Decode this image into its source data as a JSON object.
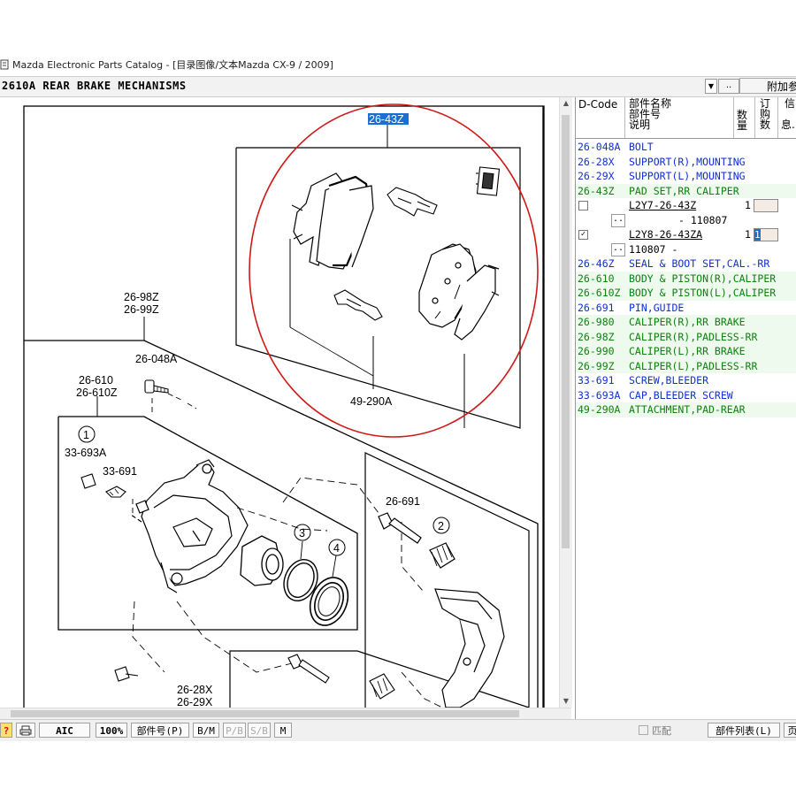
{
  "window": {
    "title": "Mazda Electronic Parts Catalog - [目录图像/文本Mazda CX-9 / 2009]"
  },
  "section": {
    "title": "2610A  REAR BRAKE MECHANISMS",
    "more_label": "..",
    "attach_label": "附加",
    "attach_extra": "参"
  },
  "diagram": {
    "highlight_label": "26-43Z",
    "labels": {
      "l_26_98z": "26-98Z",
      "l_26_99z": "26-99Z",
      "l_26_048a": "26-048A",
      "l_26_610": "26-610",
      "l_26_610z": "26-610Z",
      "l_1": "1",
      "l_33_693a": "33-693A",
      "l_33_691": "33-691",
      "l_26_691": "26-691",
      "l_2": "2",
      "l_3": "3",
      "l_4": "4",
      "l_49_290a": "49-290A",
      "l_26_28x": "26-28X",
      "l_26_29x": "26-29X"
    }
  },
  "parts_panel": {
    "headers": {
      "dcode": "D-Code",
      "name1": "部件名称",
      "name2": "部件号",
      "name3": "说明",
      "qty1": "数",
      "qty2": "量",
      "order1": "订",
      "order2": "购",
      "order3": "数",
      "info1": "信",
      "info2": "息."
    },
    "rows": [
      {
        "code": "26-048A",
        "desc": "BOLT",
        "color": "blue"
      },
      {
        "code": "26-28X",
        "desc": "SUPPORT(R),MOUNTING",
        "color": "blue"
      },
      {
        "code": "26-29X",
        "desc": "SUPPORT(L),MOUNTING",
        "color": "blue"
      },
      {
        "code": "26-43Z",
        "desc": "PAD SET,RR CALIPER",
        "color": "green"
      }
    ],
    "sub_rows": [
      {
        "part": "L2Y7-26-43Z",
        "qty": "1",
        "range": "- 110807",
        "checked": false
      },
      {
        "part": "L2Y8-26-43ZA",
        "qty": "1",
        "order": "1",
        "range": "110807  -",
        "checked": true
      }
    ],
    "rows_after": [
      {
        "code": "26-46Z",
        "desc": "SEAL & BOOT SET,CAL.-RR",
        "color": "blue"
      },
      {
        "code": "26-610",
        "desc": "BODY & PISTON(R),CALIPER",
        "color": "green"
      },
      {
        "code": "26-610Z",
        "desc": "BODY & PISTON(L),CALIPER",
        "color": "green"
      },
      {
        "code": "26-691",
        "desc": "PIN,GUIDE",
        "color": "blue"
      },
      {
        "code": "26-980",
        "desc": "CALIPER(R),RR BRAKE",
        "color": "green"
      },
      {
        "code": "26-98Z",
        "desc": "CALIPER(R),PADLESS-RR",
        "color": "green"
      },
      {
        "code": "26-990",
        "desc": "CALIPER(L),RR BRAKE",
        "color": "green"
      },
      {
        "code": "26-99Z",
        "desc": "CALIPER(L),PADLESS-RR",
        "color": "green"
      },
      {
        "code": "33-691",
        "desc": "SCREW,BLEEDER",
        "color": "blue"
      },
      {
        "code": "33-693A",
        "desc": "CAP,BLEEDER SCREW",
        "color": "blue"
      },
      {
        "code": "49-290A",
        "desc": "ATTACHMENT,PAD-REAR",
        "color": "green"
      }
    ],
    "sub_more": ".."
  },
  "toolbar": {
    "help": "?",
    "print_icon": "printer-icon",
    "aic": "AIC",
    "zoom": "100%",
    "part_no": "部件号(P)",
    "bm": "B/M",
    "pb": "P/B",
    "sb": "S/B",
    "m": "M",
    "match": "匹配",
    "part_list": "部件列表(L)",
    "extra": "页"
  },
  "colors": {
    "code_blue": "#1030d0",
    "code_green": "#108010",
    "highlight_bg": "#1a6fd0",
    "circle_red": "#d01818"
  }
}
